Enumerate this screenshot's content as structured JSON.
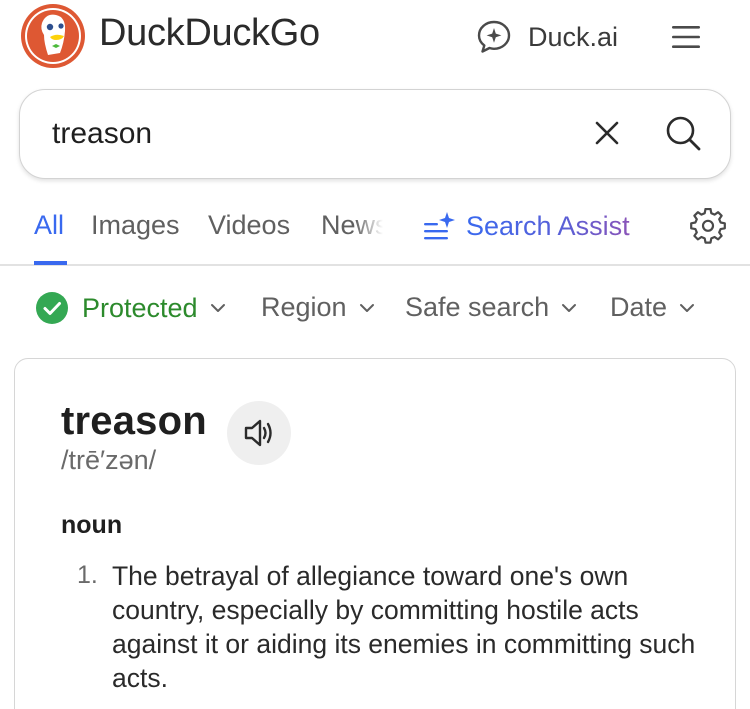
{
  "header": {
    "brand": "DuckDuckGo",
    "duck_ai_label": "Duck.ai",
    "icons": {
      "logo": "duckduckgo-logo",
      "duck_ai": "chat-sparkle-icon",
      "menu": "hamburger-menu-icon"
    }
  },
  "search": {
    "query": "treason",
    "icons": {
      "clear": "close-icon",
      "submit": "search-icon"
    }
  },
  "tabs": {
    "items": [
      "All",
      "Images",
      "Videos",
      "News"
    ],
    "active": "All",
    "assist_label": "Search Assist",
    "icons": {
      "assist": "sparkle-lines-icon",
      "settings": "gear-icon"
    }
  },
  "filters": {
    "protected": "Protected",
    "region": "Region",
    "safe_search": "Safe search",
    "date": "Date",
    "icons": {
      "protected": "check-circle-icon",
      "dropdown": "chevron-down-icon"
    }
  },
  "definition": {
    "word": "treason",
    "pronunciation": "/trē′zən/",
    "part_of_speech": "noun",
    "number": "1.",
    "text": "The betrayal of allegiance toward one's own country, especially by committing hostile acts against it or aiding its enemies in committing such acts.",
    "icons": {
      "audio": "speaker-icon"
    }
  },
  "colors": {
    "accent": "#3969ef",
    "protected_green": "#2c8a2c",
    "check_green": "#34a853",
    "logo_orange": "#de5833"
  }
}
